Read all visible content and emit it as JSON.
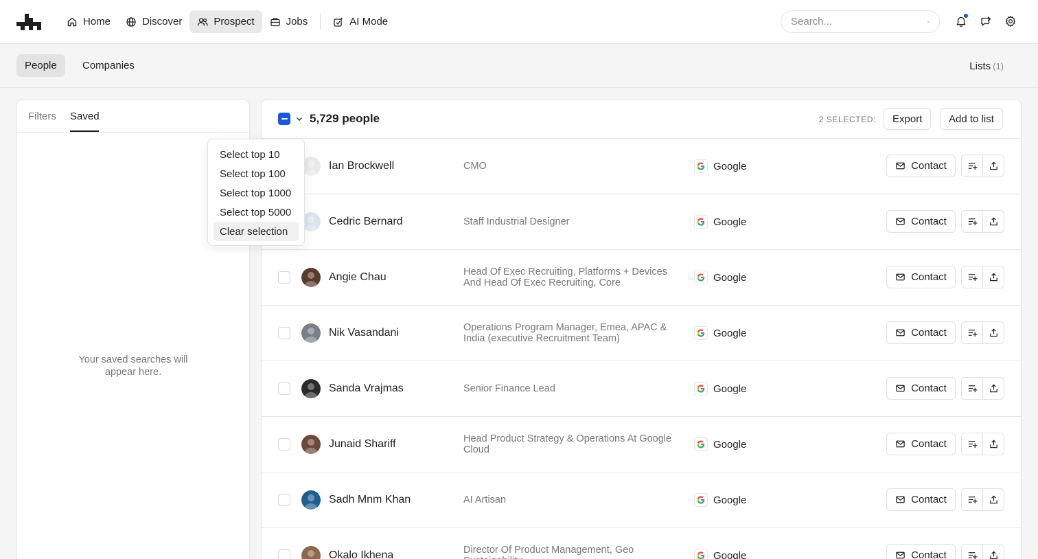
{
  "nav": {
    "items": [
      {
        "label": "Home",
        "icon": "home-icon"
      },
      {
        "label": "Discover",
        "icon": "globe-icon"
      },
      {
        "label": "Prospect",
        "icon": "users-icon",
        "active": true
      },
      {
        "label": "Jobs",
        "icon": "briefcase-icon"
      },
      {
        "label": "AI Mode",
        "icon": "sparkle-icon"
      }
    ],
    "search_placeholder": "Search..."
  },
  "subnav": {
    "tabs": [
      "People",
      "Companies"
    ],
    "active": "People",
    "lists_label": "Lists",
    "lists_count": "(1)"
  },
  "left_panel": {
    "tabs": [
      "Filters",
      "Saved"
    ],
    "active": "Saved",
    "empty_text": "Your saved searches will appear here."
  },
  "results": {
    "count_label": "5,729 people",
    "selected_label": "2 SELECTED:",
    "export_label": "Export",
    "add_to_list_label": "Add to list",
    "contact_label": "Contact",
    "people": [
      {
        "name": "Ian Brockwell",
        "title": "CMO",
        "company": "Google"
      },
      {
        "name": "Cedric Bernard",
        "title": "Staff Industrial Designer",
        "company": "Google"
      },
      {
        "name": "Angie Chau",
        "title": "Head Of Exec Recruiting, Platforms + Devices And Head Of Exec Recruiting, Core",
        "company": "Google"
      },
      {
        "name": "Nik Vasandani",
        "title": "Operations Program Manager, Emea, APAC & India (executive Recruitment Team)",
        "company": "Google"
      },
      {
        "name": "Sanda Vrajmas",
        "title": "Senior Finance Lead",
        "company": "Google"
      },
      {
        "name": "Junaid Shariff",
        "title": "Head Product Strategy & Operations At Google Cloud",
        "company": "Google"
      },
      {
        "name": "Sadh Mnm Khan",
        "title": "AI Artisan",
        "company": "Google"
      },
      {
        "name": "Okalo Ikhena",
        "title": "Director Of Product Management, Geo Sustainability",
        "company": "Google"
      }
    ]
  },
  "dropdown": {
    "items": [
      "Select top 10",
      "Select top 100",
      "Select top 1000",
      "Select top 5000",
      "Clear selection"
    ],
    "hovered": "Clear selection"
  },
  "colors": {
    "accent": "#1a56db",
    "muted_text": "#777777"
  }
}
